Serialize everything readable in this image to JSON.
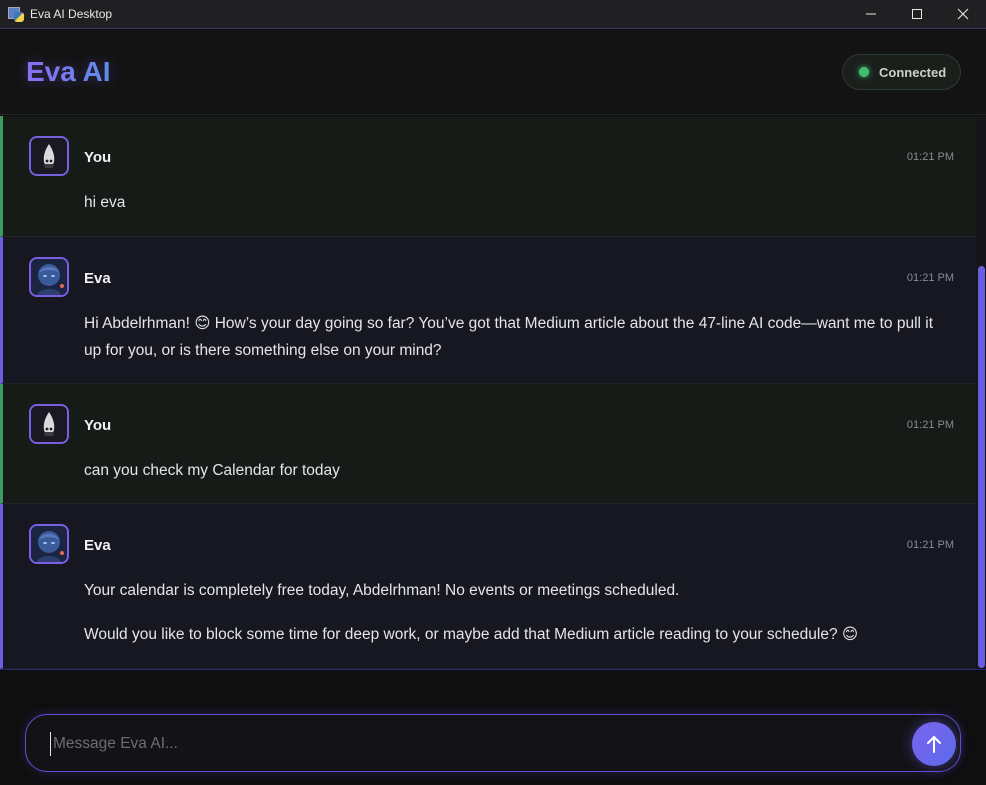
{
  "window": {
    "title": "Eva AI Desktop",
    "controls": [
      "minimize-icon",
      "maximize-icon",
      "close-icon"
    ]
  },
  "header": {
    "brand": "Eva AI",
    "status": {
      "label": "Connected",
      "color": "#3fc26d"
    }
  },
  "colors": {
    "accent": "#6a5ee0",
    "user_border": "#3f9a62",
    "ai_border": "#6a5ee0"
  },
  "messages": [
    {
      "role": "user",
      "sender": "You",
      "time": "01:21 PM",
      "paragraphs": [
        "hi eva"
      ]
    },
    {
      "role": "ai",
      "sender": "Eva",
      "time": "01:21 PM",
      "paragraphs": [
        "Hi Abdelrhman! 😊 How’s your day going so far? You’ve got that Medium article about the 47-line AI code—want me to pull it up for you, or is there something else on your mind?"
      ]
    },
    {
      "role": "user",
      "sender": "You",
      "time": "01:21 PM",
      "paragraphs": [
        "can you check my Calendar for today"
      ]
    },
    {
      "role": "ai",
      "sender": "Eva",
      "time": "01:21 PM",
      "paragraphs": [
        "Your calendar is completely free today, Abdelrhman! No events or meetings scheduled.",
        "Would you like to block some time for deep work, or maybe add that Medium article reading to your schedule? 😊"
      ]
    }
  ],
  "composer": {
    "placeholder": "Message Eva AI...",
    "value": "",
    "send_icon": "arrow-up-icon"
  }
}
